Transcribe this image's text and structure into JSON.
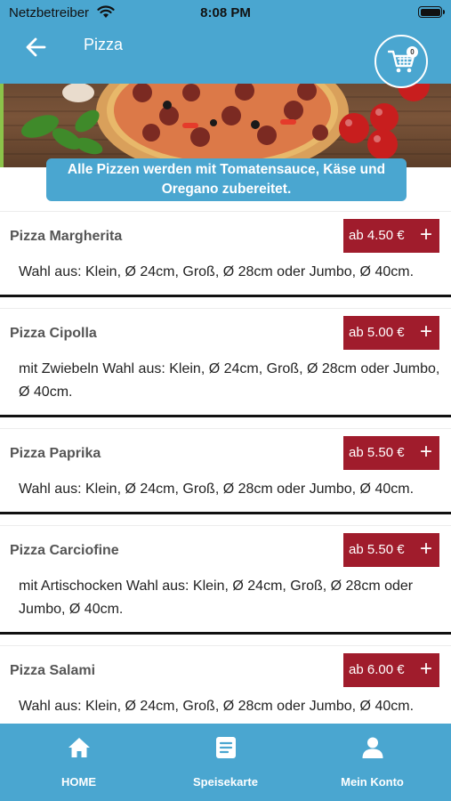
{
  "status_bar": {
    "carrier": "Netzbetreiber",
    "time": "8:08 PM"
  },
  "nav": {
    "title": "Pizza",
    "cart_count": "0"
  },
  "notice": "Alle Pizzen werden mit Tomatensauce, Käse und Oregano zubereitet.",
  "items": [
    {
      "name": "Pizza Margherita",
      "price": "ab 4.50 €",
      "description": "Wahl aus: Klein, Ø 24cm, Groß, Ø 28cm oder Jumbo, Ø 40cm."
    },
    {
      "name": "Pizza Cipolla",
      "price": "ab 5.00 €",
      "description": "mit Zwiebeln Wahl aus: Klein, Ø 24cm, Groß, Ø 28cm oder Jumbo, Ø 40cm."
    },
    {
      "name": "Pizza Paprika",
      "price": "ab 5.50 €",
      "description": "Wahl aus: Klein, Ø 24cm, Groß, Ø 28cm oder Jumbo, Ø 40cm."
    },
    {
      "name": "Pizza Carciofine",
      "price": "ab 5.50 €",
      "description": "mit Artischocken Wahl aus: Klein, Ø 24cm, Groß, Ø 28cm oder Jumbo, Ø 40cm."
    },
    {
      "name": "Pizza Salami",
      "price": "ab 6.00 €",
      "description": "Wahl aus: Klein, Ø 24cm, Groß, Ø 28cm oder Jumbo, Ø 40cm."
    }
  ],
  "add_symbol": "+",
  "tabs": [
    {
      "label": "HOME",
      "icon": "home-icon"
    },
    {
      "label": "Speisekarte",
      "icon": "menu-document-icon"
    },
    {
      "label": "Mein Konto",
      "icon": "user-icon"
    }
  ],
  "colors": {
    "brand_blue": "#4aa6d0",
    "price_red": "#a01c2c"
  }
}
